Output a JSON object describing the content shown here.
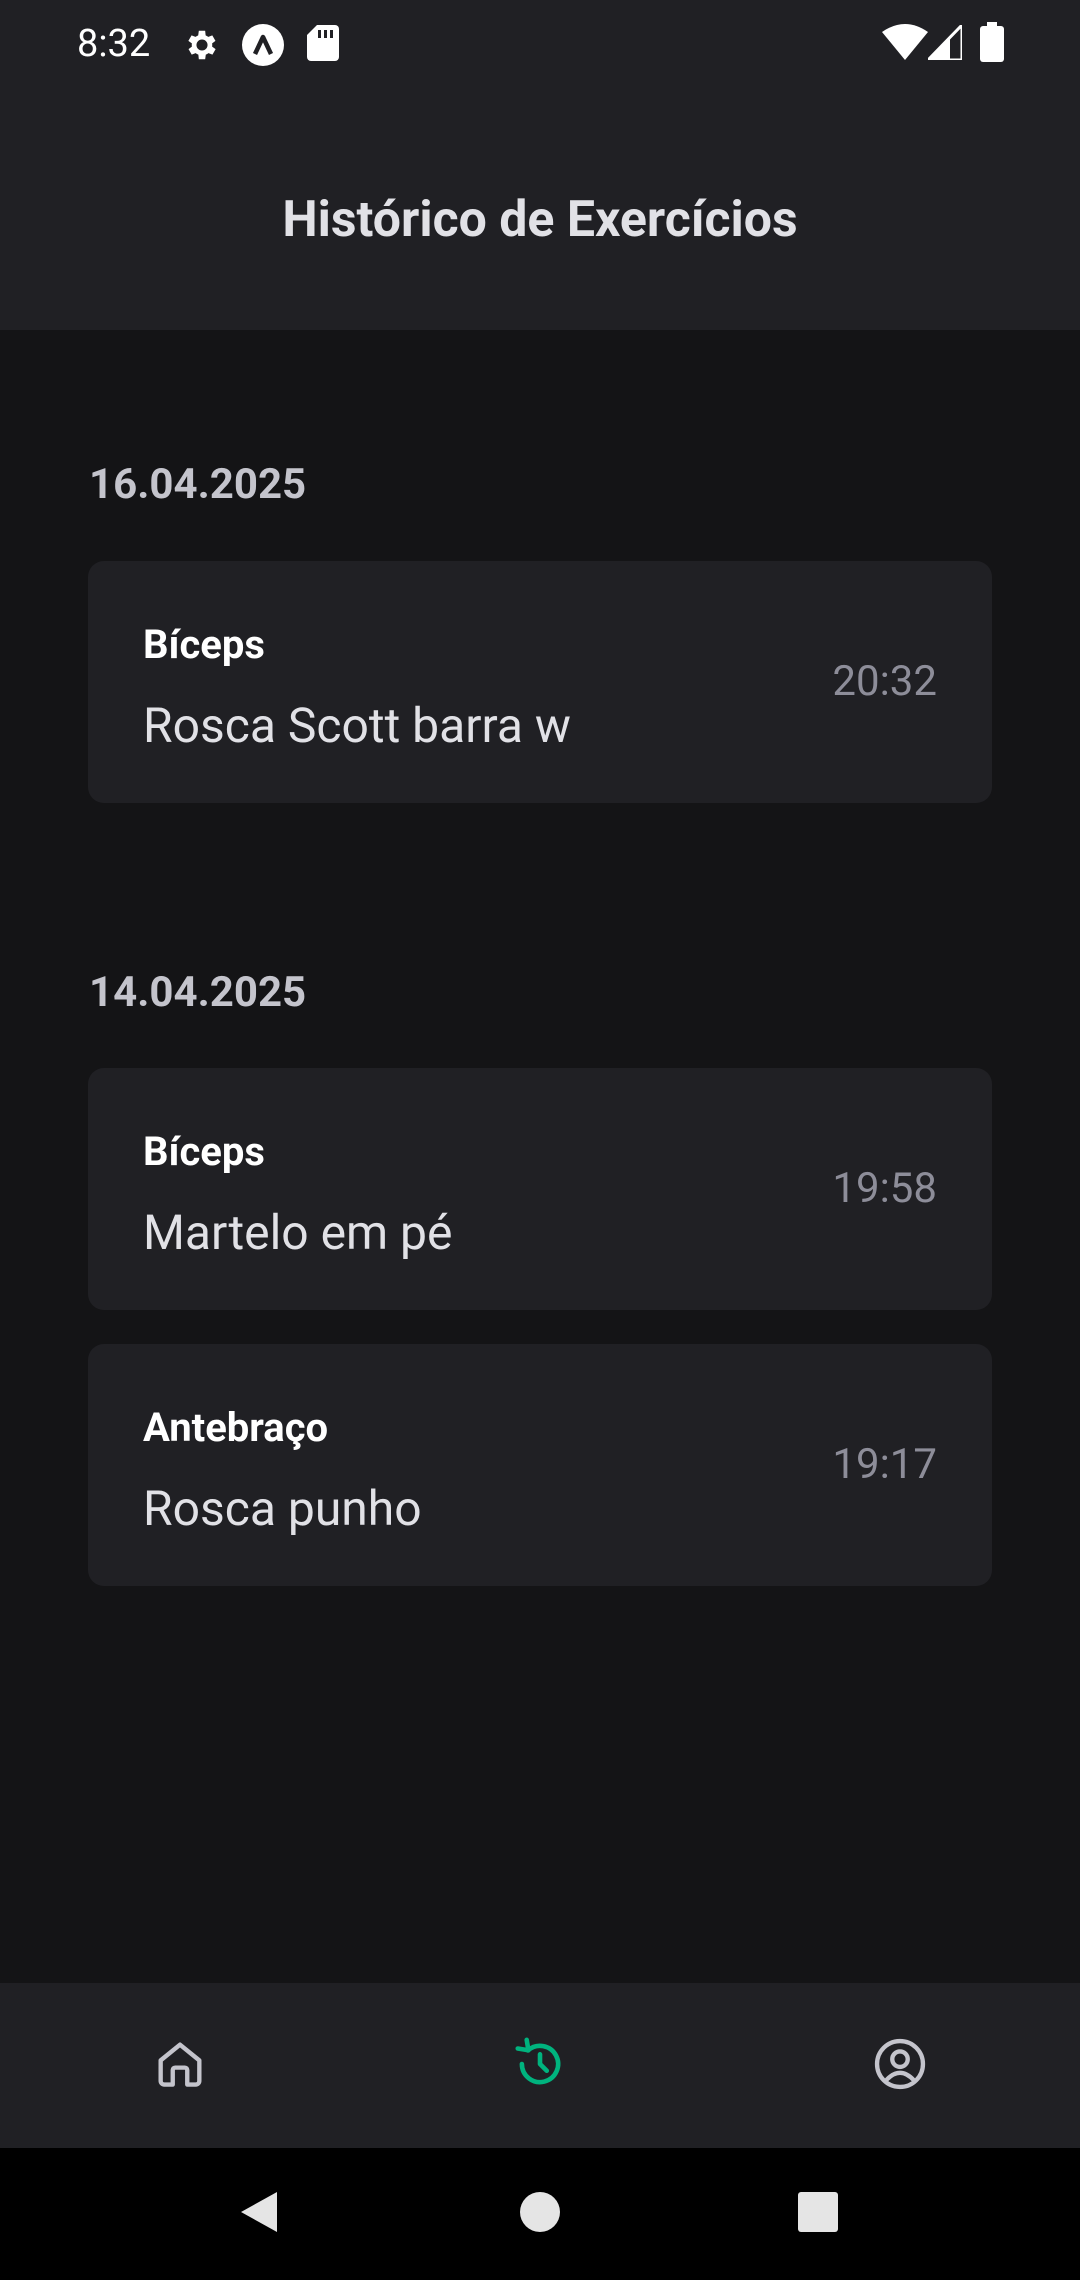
{
  "status_bar": {
    "time": "8:32",
    "left_icons": [
      "gear-icon",
      "app-logo-icon",
      "sd-card-icon"
    ],
    "right_icons": [
      "wifi-icon",
      "signal-icon",
      "battery-icon"
    ]
  },
  "header": {
    "title": "Histórico de Exercícios"
  },
  "history": {
    "sections": [
      {
        "date": "16.04.2025",
        "items": [
          {
            "group": "Bíceps",
            "exercise": "Rosca Scott barra w",
            "time": "20:32"
          }
        ]
      },
      {
        "date": "14.04.2025",
        "items": [
          {
            "group": "Bíceps",
            "exercise": "Martelo em pé",
            "time": "19:58"
          },
          {
            "group": "Antebraço",
            "exercise": "Rosca punho",
            "time": "19:17"
          }
        ]
      }
    ]
  },
  "bottom_nav": {
    "items": [
      {
        "icon": "home-icon",
        "active": false
      },
      {
        "icon": "history-icon",
        "active": true
      },
      {
        "icon": "profile-icon",
        "active": false
      }
    ],
    "active_color": "#00b37e",
    "inactive_color": "#c4c4cc"
  },
  "system_nav": {
    "buttons": [
      "back-icon",
      "home-circle-icon",
      "recents-icon"
    ]
  }
}
